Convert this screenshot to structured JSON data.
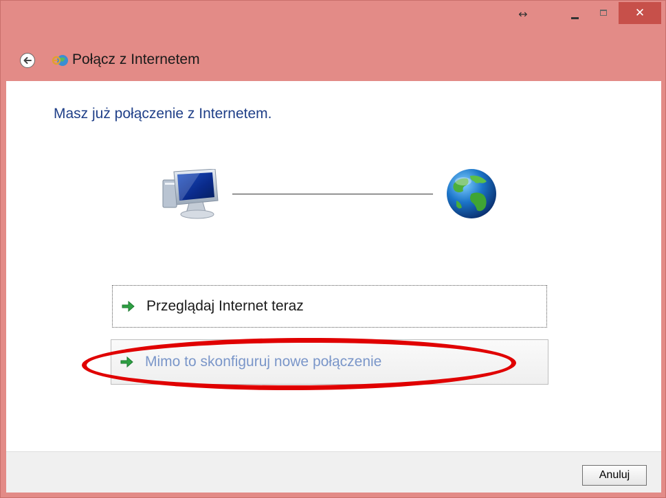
{
  "window": {
    "title": "Połącz z Internetem",
    "controls": {
      "resize": "↔",
      "close": "✕"
    }
  },
  "page": {
    "heading": "Masz już połączenie z Internetem."
  },
  "options": [
    {
      "label": "Przeglądaj Internet teraz"
    },
    {
      "label": "Mimo to skonfiguruj nowe połączenie"
    }
  ],
  "footer": {
    "cancel_label": "Anuluj"
  },
  "icons": {
    "computer": "computer-icon",
    "globe": "globe-icon",
    "arrow": "green-arrow-icon",
    "network": "network-icon",
    "back": "back-arrow-icon"
  },
  "colors": {
    "titlebar": "#e38b87",
    "close_button": "#c7504a",
    "heading": "#1f3f88",
    "highlight": "#e00000",
    "disabled_text": "#7a96c9"
  }
}
